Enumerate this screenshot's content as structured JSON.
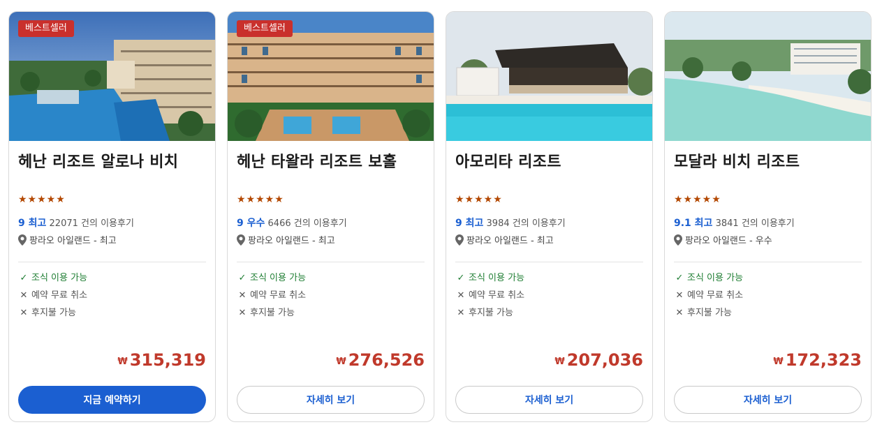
{
  "colors": {
    "accent": "#1b5fd1",
    "price": "#c0392b",
    "badge": "#c9302c",
    "star": "#b34700",
    "available": "#1e7d32"
  },
  "cards": [
    {
      "badge": "베스트셀러",
      "name": "헤난 리조트 알로나 비치",
      "stars": "★★★★★",
      "score": "9 최고",
      "review_count": "22071",
      "review_suffix": "건의 이용후기",
      "location": "팡라오 아일랜드 - 최고",
      "features": [
        {
          "label": "조식 이용 가능",
          "icon": "check-icon"
        },
        {
          "label": "예약 무료 취소",
          "icon": "x-icon"
        },
        {
          "label": "후지불 가능",
          "icon": "x-icon"
        }
      ],
      "currency": "₩",
      "price": "315,319",
      "button": "지금 예약하기"
    },
    {
      "badge": "베스트셀러",
      "name": "헤난 타왈라 리조트 보홀",
      "stars": "★★★★★",
      "score": "9 우수",
      "review_count": "6466",
      "review_suffix": "건의 이용후기",
      "location": "팡라오 아일랜드 - 최고",
      "features": [
        {
          "label": "조식 이용 가능",
          "icon": "check-icon"
        },
        {
          "label": "예약 무료 취소",
          "icon": "x-icon"
        },
        {
          "label": "후지불 가능",
          "icon": "x-icon"
        }
      ],
      "currency": "₩",
      "price": "276,526",
      "button": "자세히 보기"
    },
    {
      "badge": "",
      "name": "아모리타 리조트",
      "stars": "★★★★★",
      "score": "9 최고",
      "review_count": "3984",
      "review_suffix": "건의 이용후기",
      "location": "팡라오 아일랜드 - 최고",
      "features": [
        {
          "label": "조식 이용 가능",
          "icon": "check-icon"
        },
        {
          "label": "예약 무료 취소",
          "icon": "x-icon"
        },
        {
          "label": "후지불 가능",
          "icon": "x-icon"
        }
      ],
      "currency": "₩",
      "price": "207,036",
      "button": "자세히 보기"
    },
    {
      "badge": "",
      "name": "모달라 비치 리조트",
      "stars": "★★★★★",
      "score": "9.1 최고",
      "review_count": "3841",
      "review_suffix": "건의 이용후기",
      "location": "팡라오 아일랜드 - 우수",
      "features": [
        {
          "label": "조식 이용 가능",
          "icon": "check-icon"
        },
        {
          "label": "예약 무료 취소",
          "icon": "x-icon"
        },
        {
          "label": "후지불 가능",
          "icon": "x-icon"
        }
      ],
      "currency": "₩",
      "price": "172,323",
      "button": "자세히 보기"
    }
  ]
}
